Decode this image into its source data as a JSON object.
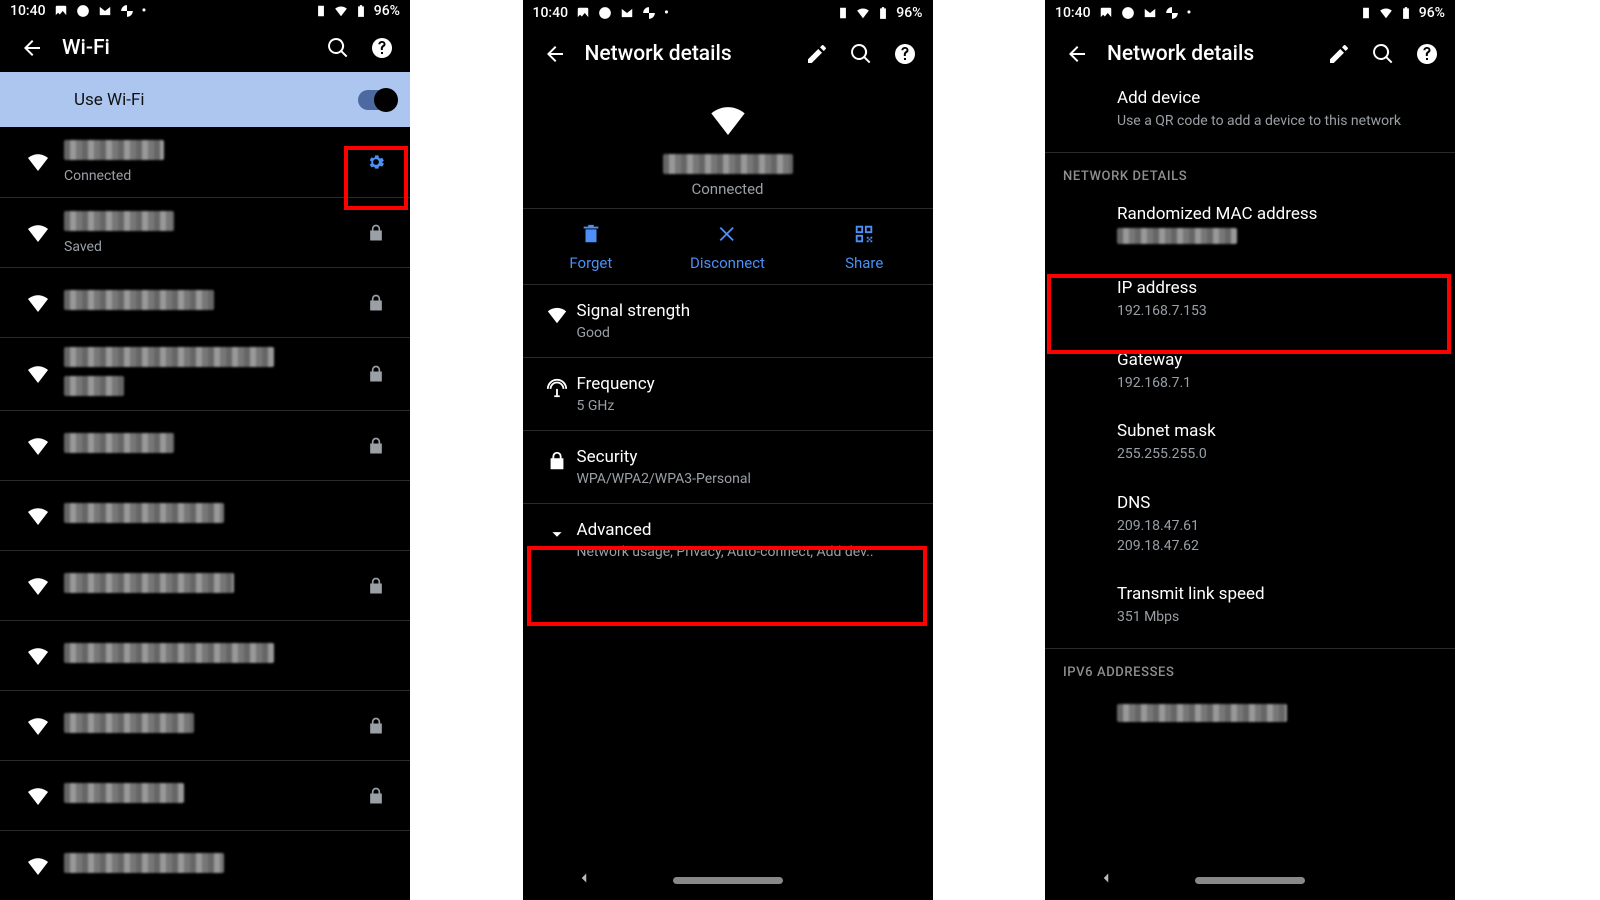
{
  "status": {
    "time": "10:40",
    "battery": "96%"
  },
  "panel1": {
    "title": "Wi-Fi",
    "use_wifi": "Use Wi-Fi",
    "connected_label": "Connected",
    "saved_label": "Saved"
  },
  "panel2": {
    "title": "Network details",
    "connected": "Connected",
    "forget": "Forget",
    "disconnect": "Disconnect",
    "share": "Share",
    "signal_t": "Signal strength",
    "signal_v": "Good",
    "freq_t": "Frequency",
    "freq_v": "5 GHz",
    "sec_t": "Security",
    "sec_v": "WPA/WPA2/WPA3-Personal",
    "adv_t": "Advanced",
    "adv_v": "Network usage, Privacy, Auto-connect, Add dev.."
  },
  "panel3": {
    "title": "Network details",
    "add_t": "Add device",
    "add_v": "Use a QR code to add a device to this network",
    "section1": "NETWORK DETAILS",
    "mac_t": "Randomized MAC address",
    "ip_t": "IP address",
    "ip_v": "192.168.7.153",
    "gw_t": "Gateway",
    "gw_v": "192.168.7.1",
    "sn_t": "Subnet mask",
    "sn_v": "255.255.255.0",
    "dns_t": "DNS",
    "dns_v1": "209.18.47.61",
    "dns_v2": "209.18.47.62",
    "tls_t": "Transmit link speed",
    "tls_v": "351 Mbps",
    "section2": "IPV6 ADDRESSES"
  }
}
